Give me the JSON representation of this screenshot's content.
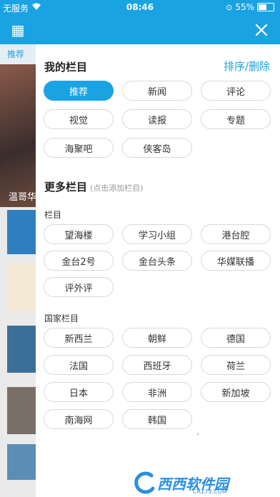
{
  "status_bar": {
    "carrier": "无服务",
    "time": "08:46",
    "battery_percent": "55%",
    "battery_level": 0.55
  },
  "background_app": {
    "tab_label": "推荐",
    "photo_caption": "温哥华"
  },
  "my_columns": {
    "title": "我的栏目",
    "sort_delete_label": "排序/删除",
    "items": [
      {
        "label": "推荐",
        "active": true
      },
      {
        "label": "新闻",
        "active": false
      },
      {
        "label": "评论",
        "active": false
      },
      {
        "label": "视觉",
        "active": false
      },
      {
        "label": "读报",
        "active": false
      },
      {
        "label": "专题",
        "active": false
      },
      {
        "label": "海聚吧",
        "active": false
      },
      {
        "label": "侠客岛",
        "active": false
      }
    ]
  },
  "more_columns": {
    "title": "更多栏目",
    "hint": "(点击添加栏目)",
    "groups": [
      {
        "title": "栏目",
        "items": [
          "望海楼",
          "学习小组",
          "港台腔",
          "金台2号",
          "金台头条",
          "华媒联播",
          "评外评"
        ]
      },
      {
        "title": "国家栏目",
        "items": [
          "新西兰",
          "朝鲜",
          "德国",
          "法国",
          "西班牙",
          "荷兰",
          "日本",
          "非洲",
          "新加坡",
          "南海网",
          "韩国"
        ]
      }
    ]
  },
  "watermark": {
    "text": "西西软件园",
    "sub": "CR173.COM"
  },
  "colors": {
    "accent": "#1aa3e3",
    "chip_border": "#d8d8d8"
  },
  "icons": {
    "close": "close-icon",
    "qr": "qr-code-icon",
    "wifi": "wifi-icon",
    "battery": "battery-icon"
  }
}
